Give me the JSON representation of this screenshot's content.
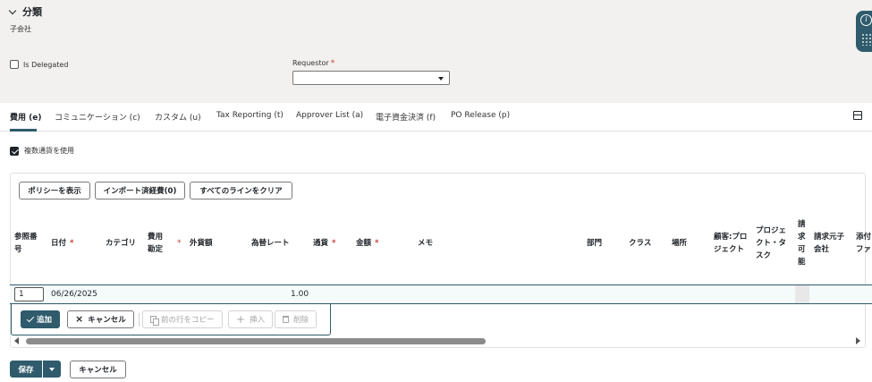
{
  "section": {
    "title": "分類",
    "subsidiary": "子会社"
  },
  "form": {
    "is_delegated_label": "Is Delegated",
    "is_delegated_checked": false,
    "requestor_label": "Requestor",
    "requestor_required_mark": "*",
    "requestor_value": ""
  },
  "side_widget": {
    "info_icon": "info-icon",
    "grip_icon": "grip-dots-icon",
    "info_glyph": "i"
  },
  "tabs": [
    {
      "label": "費用 (e)",
      "active": true
    },
    {
      "label": "コミュニケーション (c)",
      "active": false
    },
    {
      "label": "カスタム (u)",
      "active": false
    },
    {
      "label": "Tax Reporting (t)",
      "active": false
    },
    {
      "label": "Approver List (a)",
      "active": false
    },
    {
      "label": "電子資金決済 (f)",
      "active": false
    },
    {
      "label": "PO Release (p)",
      "active": false
    }
  ],
  "multicurrency": {
    "label": "複数通貨を使用",
    "checked": true
  },
  "toolbar": {
    "show_policy": "ポリシーを表示",
    "import_expenses": "インポート済経費(0)",
    "clear_all_lines": "すべてのラインをクリア"
  },
  "table": {
    "required_mark": "*",
    "headers": [
      {
        "label": "参照番号",
        "lines": [
          "参照番",
          "号"
        ],
        "required": false
      },
      {
        "label": "日付",
        "lines": [
          "日付"
        ],
        "required": true
      },
      {
        "label": "カテゴリ",
        "lines": [
          "カテゴリ"
        ],
        "required": false
      },
      {
        "label": "費用勘定",
        "lines": [
          "費用",
          "勘定"
        ],
        "required": true
      },
      {
        "label": "外貨額",
        "lines": [
          "外貨額"
        ],
        "required": false
      },
      {
        "label": "為替レート",
        "lines": [
          "為替レート"
        ],
        "required": false
      },
      {
        "label": "通貨",
        "lines": [
          "通貨"
        ],
        "required": true
      },
      {
        "label": "金額",
        "lines": [
          "金額"
        ],
        "required": true
      },
      {
        "label": "メモ",
        "lines": [
          "メモ"
        ],
        "required": false
      },
      {
        "label": "部門",
        "lines": [
          "部門"
        ],
        "required": false
      },
      {
        "label": "クラス",
        "lines": [
          "クラス"
        ],
        "required": false
      },
      {
        "label": "場所",
        "lines": [
          "場所"
        ],
        "required": false
      },
      {
        "label": "顧客:プロジェクト",
        "lines": [
          "顧客:プロ",
          "ジェクト"
        ],
        "required": false
      },
      {
        "label": "プロジェクト・タスク",
        "lines": [
          "プロジェ",
          "クト・タ",
          "スク"
        ],
        "required": false
      },
      {
        "label": "請求可能",
        "lines": [
          "請",
          "求",
          "可",
          "能"
        ],
        "required": false
      },
      {
        "label": "請求元子会社",
        "lines": [
          "請求元子",
          "会社"
        ],
        "required": false
      },
      {
        "label": "添付ファイル",
        "lines": [
          "添付",
          "ファ"
        ],
        "required": false
      }
    ],
    "row": {
      "ref_number": "1",
      "date": "06/26/2025",
      "exchange_rate": "1.00"
    }
  },
  "row_actions": {
    "add": "追加",
    "cancel": "キャンセル",
    "copy_previous": "前の行をコピー",
    "insert": "挿入",
    "delete": "削除"
  },
  "footer": {
    "save": "保存",
    "cancel": "キャンセル"
  },
  "colors": {
    "accent": "#2f5b6c",
    "required": "#c43d3d",
    "top_background": "#f2f1ef"
  }
}
